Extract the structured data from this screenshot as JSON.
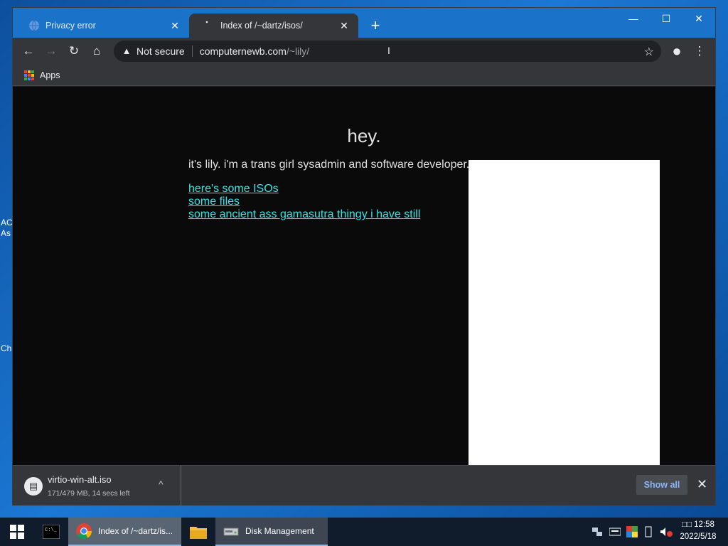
{
  "desktop": {
    "edge_labels": [
      "AC",
      "As",
      "Ch"
    ]
  },
  "browser": {
    "tabs": [
      {
        "title": "Privacy error",
        "close": "✕"
      },
      {
        "title": "Index of /~dartz/isos/",
        "close": "✕"
      }
    ],
    "new_tab": "+",
    "window_controls": {
      "minimize": "—",
      "maximize": "☐",
      "close": "✕"
    },
    "toolbar": {
      "back": "←",
      "forward": "→",
      "reload": "↻",
      "home": "⌂",
      "security_icon": "▲",
      "security_text": "Not secure",
      "url_host": "computernewb.com",
      "url_path": "/~lily/",
      "star": "☆",
      "profile": "●",
      "menu": "⋮"
    },
    "bookmarks": {
      "apps_label": "Apps"
    },
    "page": {
      "heading": "hey.",
      "intro": "it's lily. i'm a trans girl sysadmin and software developer.",
      "links": [
        "here's some ISOs",
        "some files",
        "some ancient ass gamasutra thingy i have still"
      ]
    },
    "download_shelf": {
      "filename": "virtio-win-alt.iso",
      "status": "171/479 MB, 14 secs left",
      "chevron": "^",
      "show_all": "Show all",
      "close": "✕"
    }
  },
  "taskbar": {
    "chrome_label": "Index of /~dartz/is...",
    "disk_label": "Disk Management",
    "clock_time": "12:58",
    "clock_prefix": "□□",
    "clock_date": "2022/5/18"
  },
  "colors": {
    "link": "#2ee6e6",
    "tabstrip": "#1a73c8",
    "toolbar": "#35363a",
    "page_bg": "#0a0a0a"
  }
}
